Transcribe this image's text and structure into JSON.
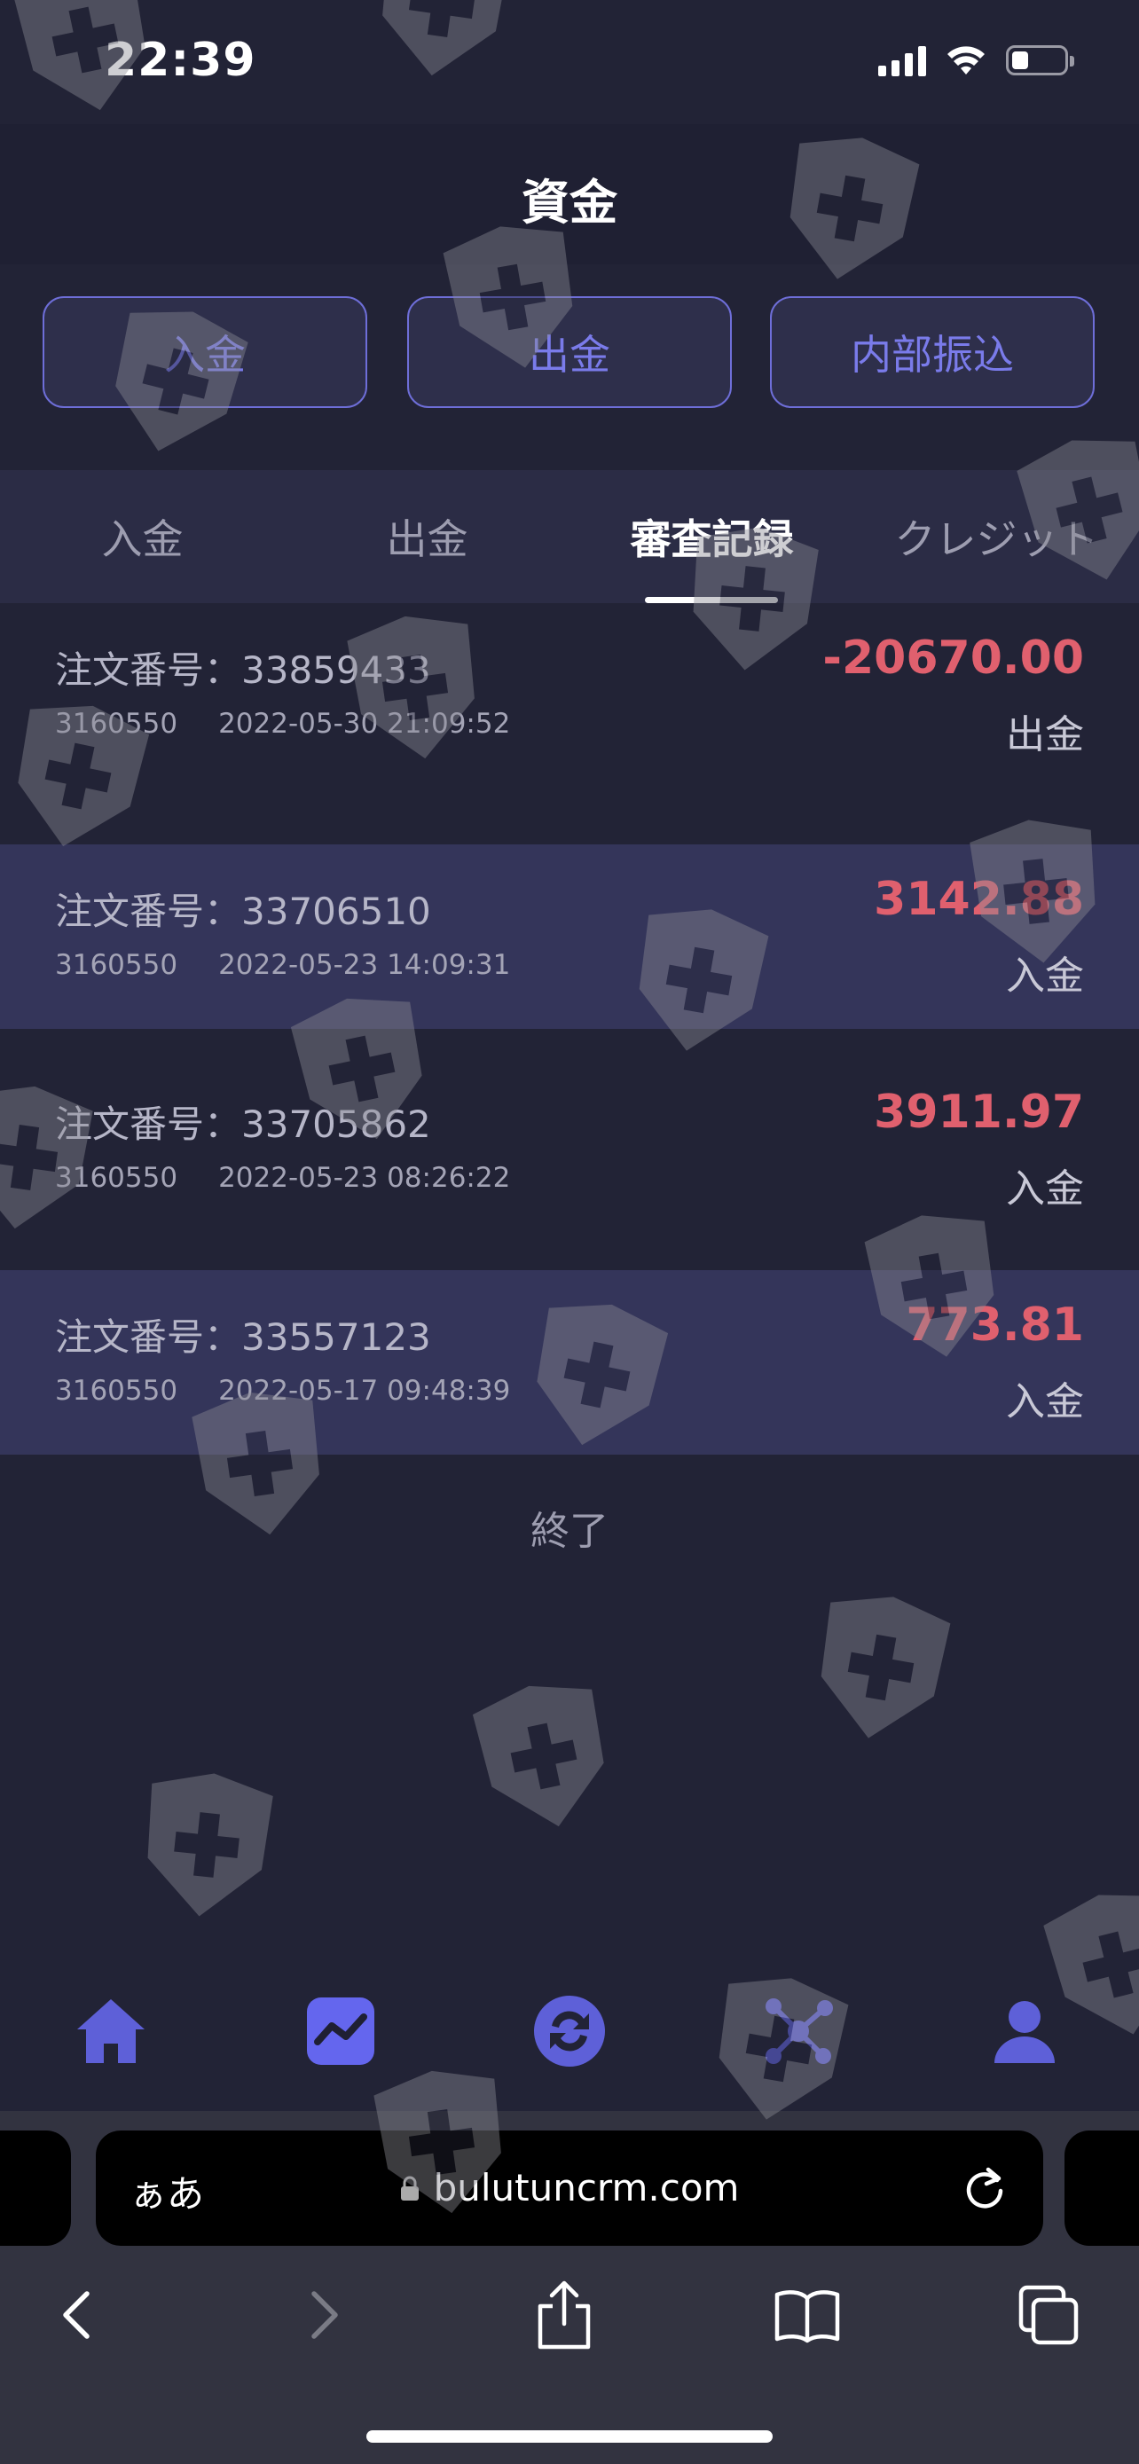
{
  "status_bar": {
    "time": "22:39"
  },
  "header": {
    "title": "資金"
  },
  "actions": {
    "deposit": "入金",
    "withdraw": "出金",
    "transfer": "内部振込"
  },
  "tabs": [
    {
      "label": "入金",
      "active": false
    },
    {
      "label": "出金",
      "active": false
    },
    {
      "label": "審査記録",
      "active": true
    },
    {
      "label": "クレジット",
      "active": false
    }
  ],
  "records": [
    {
      "order": "注文番号：33859433",
      "account": "3160550",
      "datetime": "2022-05-30 21:09:52",
      "amount": "-20670.00",
      "type": "出金"
    },
    {
      "order": "注文番号：33706510",
      "account": "3160550",
      "datetime": "2022-05-23 14:09:31",
      "amount": "3142.88",
      "type": "入金"
    },
    {
      "order": "注文番号：33705862",
      "account": "3160550",
      "datetime": "2022-05-23 08:26:22",
      "amount": "3911.97",
      "type": "入金"
    },
    {
      "order": "注文番号：33557123",
      "account": "3160550",
      "datetime": "2022-05-17 09:48:39",
      "amount": "773.81",
      "type": "入金"
    }
  ],
  "end_text": "終了",
  "bottom_nav": {
    "items": [
      "home-icon",
      "chart-icon",
      "exchange-icon",
      "network-icon",
      "user-icon"
    ],
    "accent_color": "#5e60d8",
    "active_color": "#6466ee"
  },
  "browser": {
    "aa_label": "ぁあ",
    "url": "bulutuncrm.com"
  },
  "colors": {
    "background": "#222336",
    "amount": "#e0606e",
    "accent": "#7a7bea"
  }
}
